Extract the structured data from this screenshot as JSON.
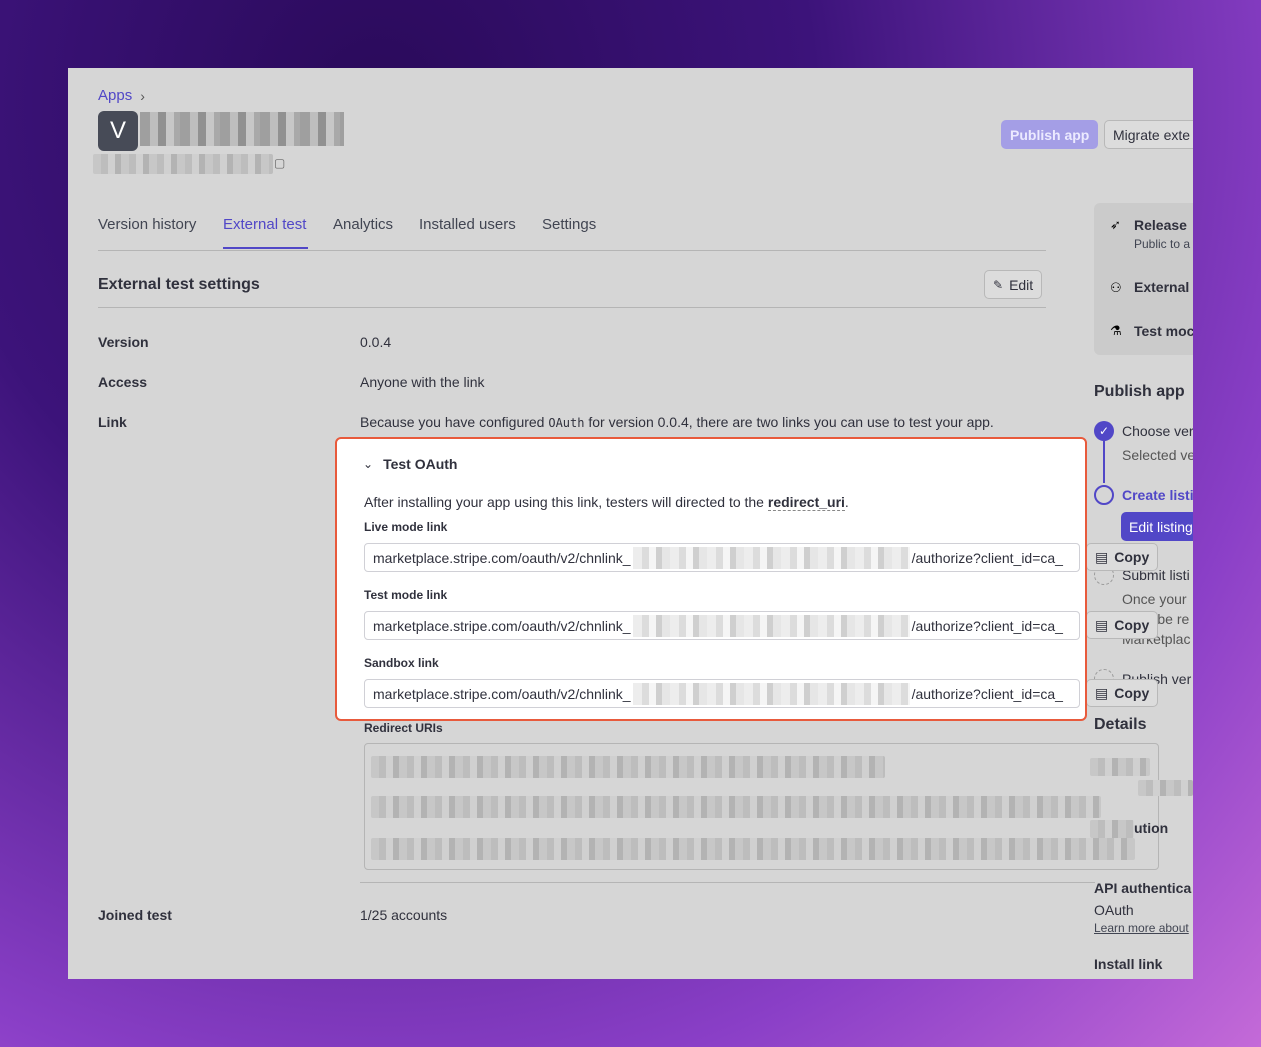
{
  "header": {
    "breadcrumb": "Apps",
    "avatar_letter": "V",
    "publish_button": "Publish app",
    "migrate_button": "Migrate exte"
  },
  "tabs": [
    {
      "label": "Version history"
    },
    {
      "label": "External test"
    },
    {
      "label": "Analytics"
    },
    {
      "label": "Installed users"
    },
    {
      "label": "Settings"
    }
  ],
  "section": {
    "title": "External test settings",
    "edit_button": "Edit"
  },
  "settings": {
    "version_label": "Version",
    "version_value": "0.0.4",
    "access_label": "Access",
    "access_value": "Anyone with the link",
    "link_label": "Link",
    "link_text_prefix": "Because you have configured ",
    "link_text_code": "OAuth",
    "link_text_suffix": " for version 0.0.4, there are two links you can use to test your app.",
    "joined_label": "Joined test",
    "joined_value": "1/25 accounts"
  },
  "oauth_panel": {
    "title": "Test OAuth",
    "description_prefix": "After installing your app using this link, testers will directed to the ",
    "description_code": "redirect_uri",
    "description_suffix": ".",
    "live_label": "Live mode link",
    "live_prefix": "marketplace.stripe.com/oauth/v2/chnlink_",
    "live_suffix": "/authorize?client_id=ca_",
    "test_label": "Test mode link",
    "test_prefix": "marketplace.stripe.com/oauth/v2/chnlink_",
    "test_suffix": "/authorize?client_id=ca_",
    "sandbox_label": "Sandbox link",
    "sandbox_prefix": "marketplace.stripe.com/oauth/v2/chnlink_",
    "sandbox_suffix": "/authorize?client_id=ca_",
    "copy_label": "Copy"
  },
  "redirect": {
    "label": "Redirect URIs"
  },
  "sidebar": {
    "release_title": "Release",
    "release_sub": "Public to a",
    "external": "External",
    "test_mode": "Test moc",
    "publish_heading": "Publish app",
    "step1_title": "Choose ver",
    "step1_sub": "Selected ve",
    "step2_title": "Create listi",
    "edit_listing": "Edit listing",
    "step3_title": "Submit listi",
    "step3_sub1": "Once your",
    "step3_sub2": "you'll be re",
    "step3_sub3": "Marketplac",
    "step4_title": "Publish ver",
    "details_heading": "Details",
    "distribution": "ution",
    "api_auth": "API authentica",
    "api_value": "OAuth",
    "learn_more": "Learn more about",
    "install_link": "Install link"
  },
  "colors": {
    "accent": "#5147c7",
    "highlight_border": "#e85a3c"
  }
}
